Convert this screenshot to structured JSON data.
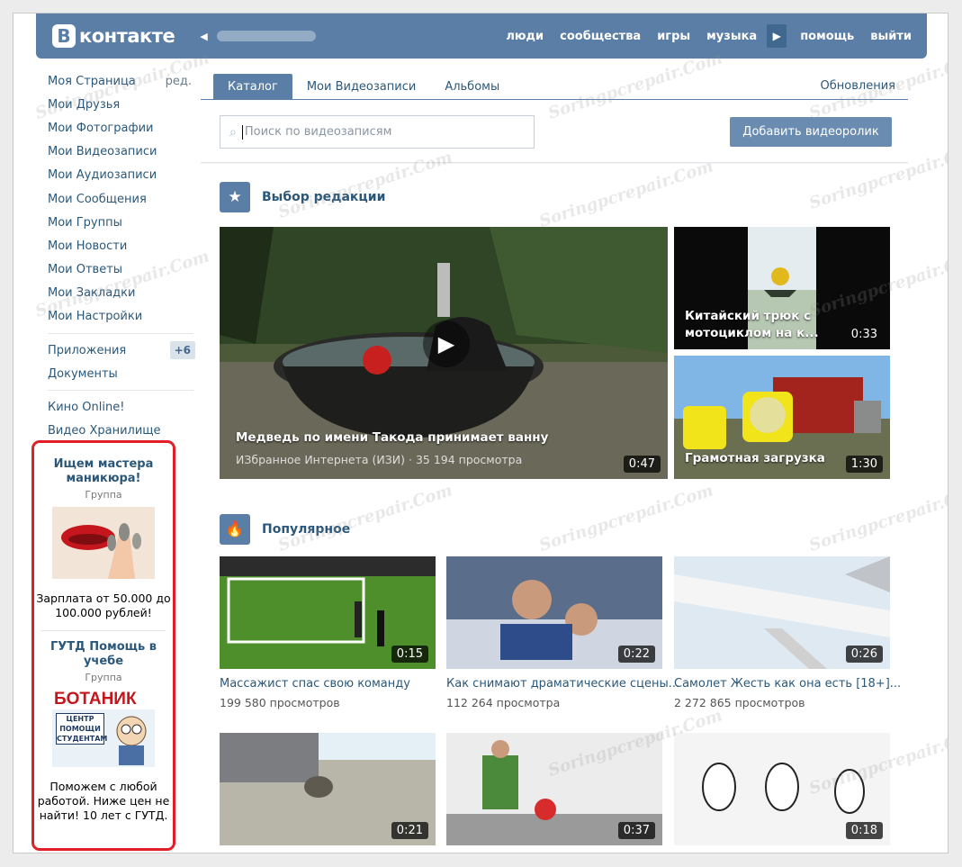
{
  "header": {
    "logo_letter": "В",
    "logo_text": "контакте",
    "nav": [
      "люди",
      "сообщества",
      "игры",
      "музыка",
      "помощь",
      "выйти"
    ]
  },
  "left_menu": {
    "edit_label": "ред.",
    "group1": [
      "Моя Страница",
      "Мои Друзья",
      "Мои Фотографии",
      "Мои Видеозаписи",
      "Мои Аудиозаписи",
      "Мои Сообщения",
      "Мои Группы",
      "Мои Новости",
      "Мои Ответы",
      "Мои Закладки",
      "Мои Настройки"
    ],
    "group2": [
      "Приложения",
      "Документы"
    ],
    "apps_badge": "+6",
    "group3": [
      "Кино Online!",
      "Видео Хранилище"
    ]
  },
  "ads": [
    {
      "title": "Ищем мастера маникюра!",
      "type": "Группа",
      "text": "Зарплата от 50.000 до 100.000 рублей!"
    },
    {
      "title": "ГУТД Помощь в учебе",
      "type": "Группа",
      "image_title": "БОТАНИК",
      "image_sub": "ЦЕНТР ПОМОЩИ СТУДЕНТАМ",
      "text": "Поможем с любой работой. Ниже цен не найти! 10 лет с ГУТД."
    }
  ],
  "tabs": {
    "items": [
      "Каталог",
      "Мои Видеозаписи",
      "Альбомы"
    ],
    "active": "Каталог",
    "updates": "Обновления"
  },
  "search": {
    "placeholder": "Поиск по видеозаписям",
    "add_button": "Добавить видеоролик"
  },
  "editors_choice": {
    "title": "Выбор редакции",
    "main": {
      "title": "Медведь по имени Такода принимает ванну",
      "channel": "ИЗбранное Интернета (ИЗИ)",
      "views": "35 194 просмотра",
      "duration": "0:47"
    },
    "side": [
      {
        "title": "Китайский трюк с мотоциклом на к...",
        "duration": "0:33"
      },
      {
        "title": "Грамотная загрузка",
        "duration": "1:30"
      }
    ]
  },
  "popular": {
    "title": "Популярное",
    "videos": [
      {
        "title": "Массажист спас свою команду",
        "views": "199 580 просмотров",
        "duration": "0:15"
      },
      {
        "title": "Как снимают драматические сцены...",
        "views": "112 264 просмотра",
        "duration": "0:22"
      },
      {
        "title": "Самолет Жесть как она есть [18+]...",
        "views": "2 272 865 просмотров",
        "duration": "0:26"
      },
      {
        "title": "",
        "views": "",
        "duration": "0:21"
      },
      {
        "title": "",
        "views": "",
        "duration": "0:37"
      },
      {
        "title": "",
        "views": "",
        "duration": "0:18"
      }
    ]
  },
  "watermark": "Soringpcrepair.Com",
  "colors": {
    "brand": "#5a7ea5",
    "link": "#2b587a",
    "ad_border": "#e11f27"
  }
}
